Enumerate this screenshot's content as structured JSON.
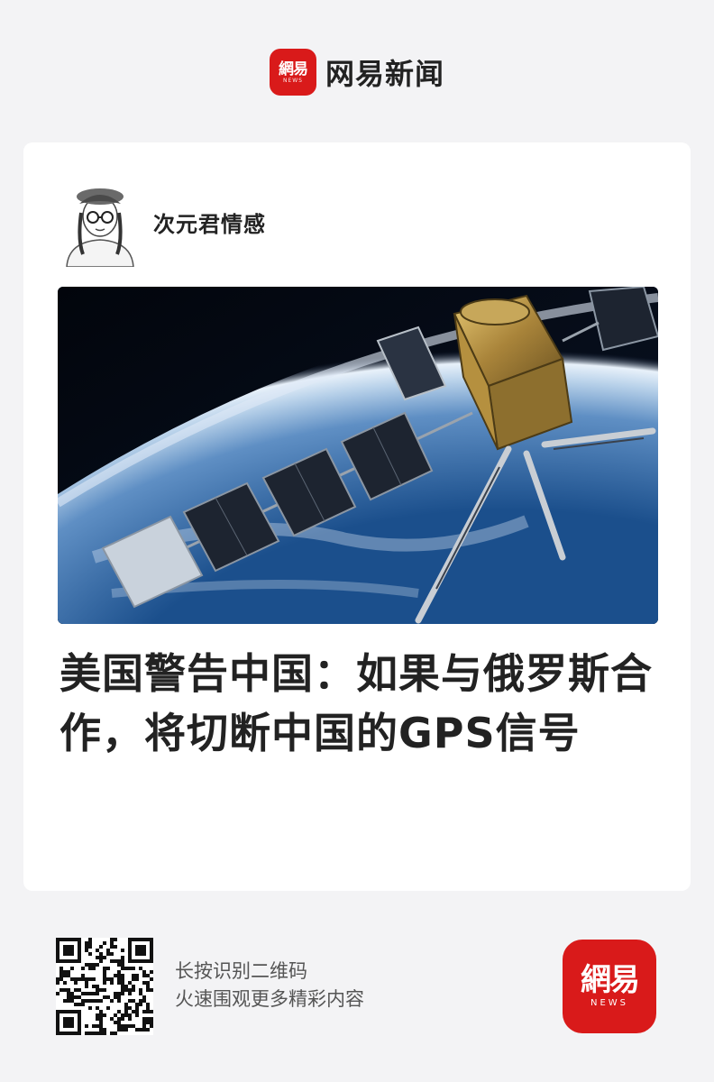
{
  "header": {
    "logo_text": "網易",
    "logo_subtext": "NEWS",
    "brand_name": "网易新闻"
  },
  "colors": {
    "brand_red": "#d91a1a",
    "background": "#f3f3f5",
    "card": "#ffffff",
    "text": "#222222"
  },
  "article": {
    "author_name": "次元君情感",
    "author_avatar_icon": "avatar-illustration-icon",
    "hero_image_icon": "satellite-in-orbit-image",
    "headline": "美国警告中国：如果与俄罗斯合作，将切断中国的GPS信号"
  },
  "footer": {
    "qr_icon": "qr-code-icon",
    "qr_line1": "长按识别二维码",
    "qr_line2": "火速围观更多精彩内容",
    "logo_text": "網易",
    "logo_subtext": "NEWS"
  }
}
